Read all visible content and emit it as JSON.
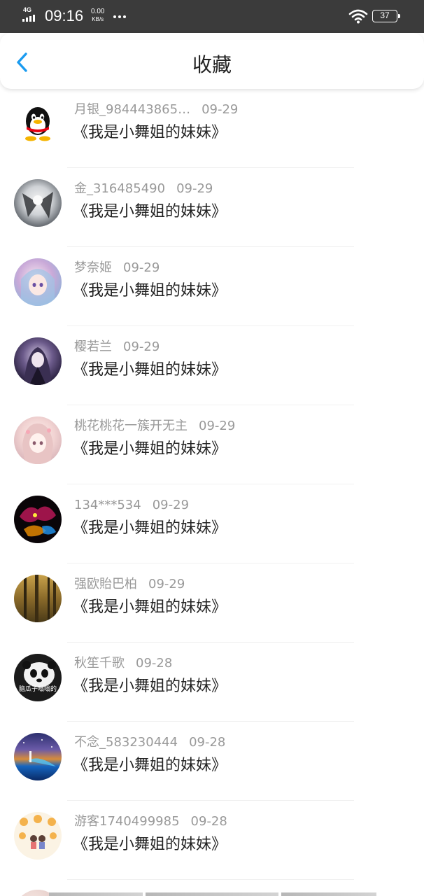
{
  "status_bar": {
    "network": "4G",
    "time": "09:16",
    "speed_value": "0.00",
    "speed_unit": "KB/s",
    "battery": "37"
  },
  "header": {
    "title": "收藏",
    "accent_color": "#1a9bf0"
  },
  "items": [
    {
      "user": "月银_984443865…",
      "date": "09-29",
      "title": "《我是小舞姐的妹妹》",
      "avatar_icon": "qq-penguin-icon"
    },
    {
      "user": "金_316485490",
      "date": "09-29",
      "title": "《我是小舞姐的妹妹》",
      "avatar_icon": "anime-mecha-avatar"
    },
    {
      "user": "梦奈姬",
      "date": "09-29",
      "title": "《我是小舞姐的妹妹》",
      "avatar_icon": "anime-girl-avatar"
    },
    {
      "user": "樱若兰",
      "date": "09-29",
      "title": "《我是小舞姐的妹妹》",
      "avatar_icon": "anime-girl-dark-avatar"
    },
    {
      "user": "桃花桃花一簇开无主",
      "date": "09-29",
      "title": "《我是小舞姐的妹妹》",
      "avatar_icon": "anime-girl-pink-avatar"
    },
    {
      "user": "134***534",
      "date": "09-29",
      "title": "《我是小舞姐的妹妹》",
      "avatar_icon": "dark-creature-avatar"
    },
    {
      "user": "强欧貽巴柏",
      "date": "09-29",
      "title": "《我是小舞姐的妹妹》",
      "avatar_icon": "forest-avatar"
    },
    {
      "user": "秋笙千歌",
      "date": "09-28",
      "title": "《我是小舞姐的妹妹》",
      "avatar_icon": "panda-avatar",
      "avatar_caption": "脑瓜子嗡嗡的"
    },
    {
      "user": "不念_583230444",
      "date": "09-28",
      "title": "《我是小舞姐的妹妹》",
      "avatar_icon": "night-sky-avatar"
    },
    {
      "user": "游客1740499985",
      "date": "09-28",
      "title": "《我是小舞姐的妹妹》",
      "avatar_icon": "cartoon-couple-avatar"
    }
  ]
}
